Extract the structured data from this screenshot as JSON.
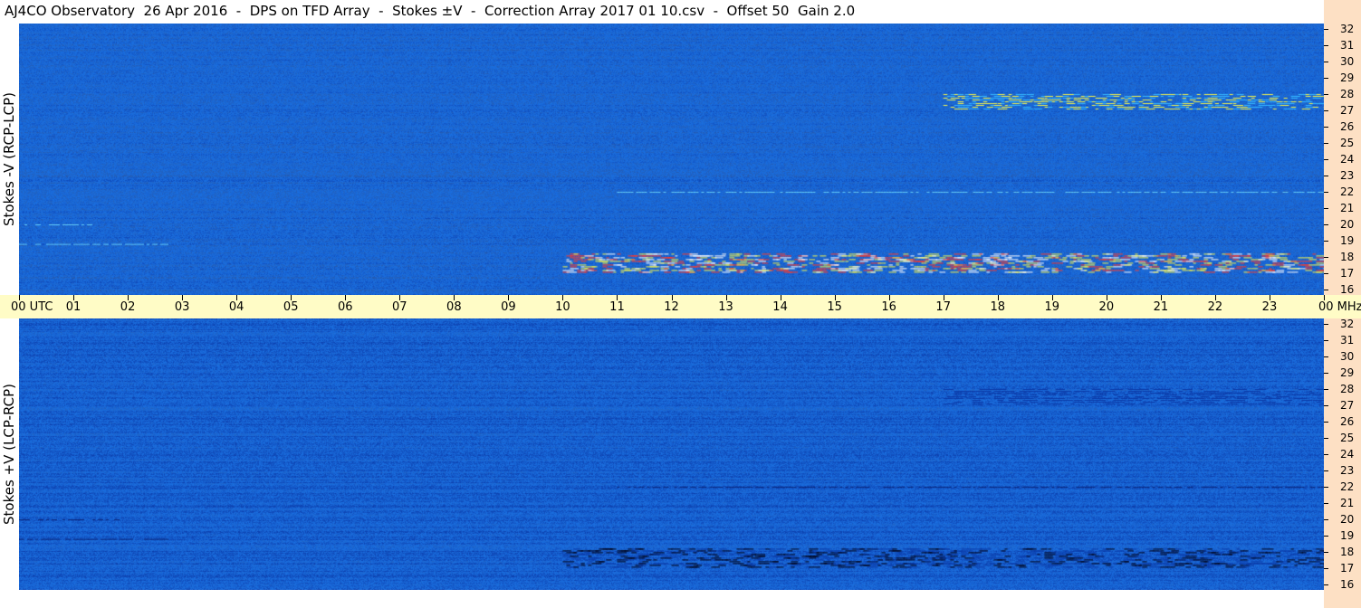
{
  "title": "AJ4CO Observatory  26 Apr 2016  -  DPS on TFD Array  -  Stokes ±V  -  Correction Array 2017 01 10.csv  -  Offset 50  Gain 2.0",
  "colors": {
    "background_blue": "#1a6fe0",
    "dark_blue": "#0b3aa8",
    "cyan": "#35b8ff",
    "time_bar": "#fffcc6",
    "freq_strip": "#fde0c4",
    "accent_yellow": "#f4f44a",
    "accent_red": "#ff3a2a"
  },
  "chart_data": [
    {
      "type": "heatmap",
      "ylabel": "Stokes -V (RCP-LCP)",
      "y_unit": "MHz",
      "x_ticks": [
        "00 UTC",
        "01",
        "02",
        "03",
        "04",
        "05",
        "06",
        "07",
        "08",
        "09",
        "10",
        "11",
        "12",
        "13",
        "14",
        "15",
        "16",
        "17",
        "18",
        "19",
        "20",
        "21",
        "22",
        "23",
        "00"
      ],
      "y_ticks": [
        "32",
        "31",
        "30",
        "29",
        "28",
        "27",
        "26",
        "25",
        "24",
        "23",
        "22",
        "21",
        "20",
        "19",
        "18",
        "17",
        "16"
      ],
      "ylim": [
        16,
        32
      ],
      "xlim_hours": [
        0,
        24
      ],
      "features": [
        {
          "type": "broadband_bright_band",
          "freq_MHz": [
            17,
            18.2
          ],
          "time_hours": [
            10,
            24
          ],
          "colors": [
            "yellow",
            "red",
            "white"
          ]
        },
        {
          "type": "speckle_band",
          "freq_MHz": [
            27,
            28
          ],
          "time_hours": [
            17,
            24
          ],
          "colors": [
            "cyan",
            "yellow"
          ]
        },
        {
          "type": "interference_line",
          "freq_MHz": 20,
          "time_hours": [
            0,
            1.3
          ]
        },
        {
          "type": "interference_line",
          "freq_MHz": 18.8,
          "time_hours": [
            0,
            2.7
          ]
        },
        {
          "type": "interference_line",
          "freq_MHz": 22,
          "time_hours": [
            11,
            24
          ]
        }
      ]
    },
    {
      "type": "heatmap",
      "ylabel": "Stokes +V (LCP-RCP)",
      "y_unit": "MHz",
      "x_ticks": [
        "00 UTC",
        "01",
        "02",
        "03",
        "04",
        "05",
        "06",
        "07",
        "08",
        "09",
        "10",
        "11",
        "12",
        "13",
        "14",
        "15",
        "16",
        "17",
        "18",
        "19",
        "20",
        "21",
        "22",
        "23",
        "00"
      ],
      "y_ticks": [
        "32",
        "31",
        "30",
        "29",
        "28",
        "27",
        "26",
        "25",
        "24",
        "23",
        "22",
        "21",
        "20",
        "19",
        "18",
        "17",
        "16"
      ],
      "ylim": [
        16,
        32
      ],
      "xlim_hours": [
        0,
        24
      ],
      "features": [
        {
          "type": "broadband_dark_band",
          "freq_MHz": [
            17,
            18.2
          ],
          "time_hours": [
            10,
            24
          ],
          "colors": [
            "black",
            "dark_blue"
          ]
        },
        {
          "type": "dark_band",
          "freq_MHz": [
            27,
            28
          ],
          "time_hours": [
            17,
            24
          ],
          "colors": [
            "dark_blue"
          ]
        },
        {
          "type": "interference_line",
          "freq_MHz": 20,
          "time_hours": [
            0,
            1.8
          ]
        },
        {
          "type": "interference_line",
          "freq_MHz": 18.8,
          "time_hours": [
            0,
            2.7
          ]
        },
        {
          "type": "interference_line",
          "freq_MHz": 22,
          "time_hours": [
            11,
            24
          ]
        }
      ]
    }
  ],
  "freq_unit_label": "MHz",
  "time_label_first": "00 UTC"
}
